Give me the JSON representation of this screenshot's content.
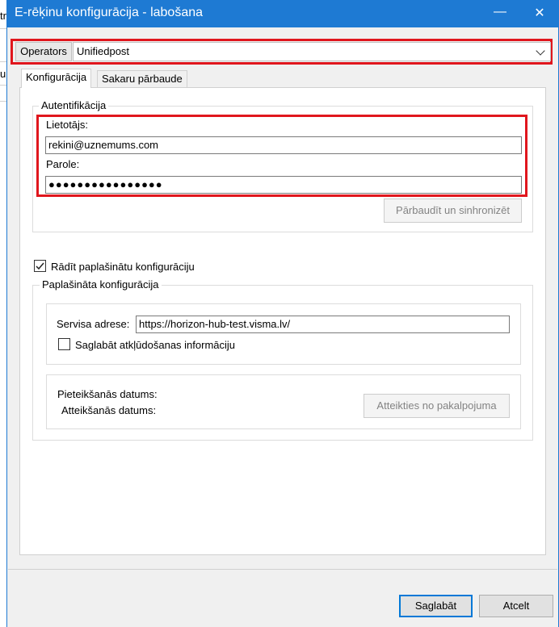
{
  "window": {
    "title": "E-rēķinu konfigurācija - labošana",
    "minimize_icon": "minimize-icon",
    "close_icon": "close-icon"
  },
  "background_fragments": [
    "tr",
    "u"
  ],
  "operator": {
    "label": "Operators",
    "value": "Unifiedpost"
  },
  "tabs": [
    {
      "label": "Konfigurācija",
      "active": true
    },
    {
      "label": "Sakaru pārbaude",
      "active": false
    }
  ],
  "auth": {
    "group_title": "Autentifikācija",
    "user_label": "Lietotājs:",
    "user_value": "rekini@uznemums.com",
    "password_label": "Parole:",
    "password_mask": "●●●●●●●●●●●●●●●●",
    "verify_button": "Pārbaudīt un sinhronizēt"
  },
  "extended": {
    "checkbox_label": "Rādīt paplašinātu konfigurāciju",
    "checkbox_checked": true,
    "group_title": "Paplašināta konfigurācija",
    "service_label": "Servisa adrese:",
    "service_value": "https://horizon-hub-test.visma.lv/",
    "debug_label": "Saglabāt atkļūdošanas informāciju",
    "debug_checked": false,
    "signup_label": "Pieteikšanās datums:",
    "cancel_label": "Atteikšanās datums:",
    "unsubscribe_button": "Atteikties no pakalpojuma"
  },
  "footer": {
    "save_button": "Saglabāt",
    "cancel_button": "Atcelt"
  },
  "colors": {
    "titlebar": "#1e7ad3",
    "highlight": "#e0161d"
  }
}
